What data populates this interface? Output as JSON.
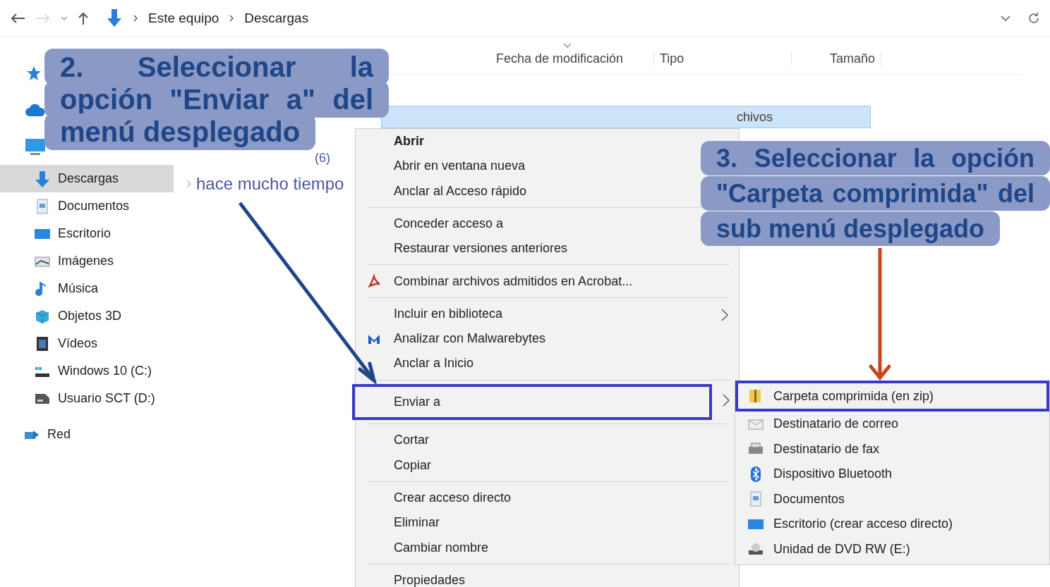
{
  "address_bar": {
    "breadcrumb": [
      "Este equipo",
      "Descargas"
    ]
  },
  "sidebar": {
    "items": [
      {
        "label": "Descargas",
        "selected": true
      },
      {
        "label": "Documentos",
        "selected": false
      },
      {
        "label": "Escritorio",
        "selected": false
      },
      {
        "label": "Imágenes",
        "selected": false
      },
      {
        "label": "Música",
        "selected": false
      },
      {
        "label": "Objetos 3D",
        "selected": false
      },
      {
        "label": "Vídeos",
        "selected": false
      },
      {
        "label": "Windows 10 (C:)",
        "selected": false
      },
      {
        "label": "Usuario SCT (D:)",
        "selected": false
      },
      {
        "label": "Red",
        "selected": false
      }
    ]
  },
  "file_list": {
    "columns": [
      "Fecha de modificación",
      "Tipo",
      "Tamaño"
    ],
    "selected_row": {
      "visible_text": "chivos",
      "selected": true
    },
    "group_count": "(6)",
    "group_header": "hace mucho tiempo"
  },
  "context_menu": {
    "items": [
      {
        "kind": "item",
        "label": "Abrir",
        "default": true,
        "selected": false
      },
      {
        "kind": "item",
        "label": "Abrir en ventana nueva",
        "default": false,
        "selected": false
      },
      {
        "kind": "item",
        "label": "Anclar al Acceso rápido",
        "default": false,
        "selected": false
      },
      {
        "kind": "separator"
      },
      {
        "kind": "item",
        "label": "Conceder acceso a",
        "default": false,
        "selected": false
      },
      {
        "kind": "item",
        "label": "Restaurar versiones anteriores",
        "default": false,
        "selected": false
      },
      {
        "kind": "separator"
      },
      {
        "kind": "item",
        "label": "Combinar archivos admitidos en Acrobat...",
        "default": false,
        "selected": false
      },
      {
        "kind": "separator"
      },
      {
        "kind": "submenu",
        "label": "Incluir en biblioteca",
        "default": false,
        "selected": false
      },
      {
        "kind": "item",
        "label": "Analizar con Malwarebytes",
        "default": false,
        "selected": false
      },
      {
        "kind": "item",
        "label": "Anclar a Inicio",
        "default": false,
        "selected": false
      },
      {
        "kind": "separator"
      },
      {
        "kind": "submenu",
        "label": "Enviar a",
        "default": false,
        "selected": true
      },
      {
        "kind": "separator"
      },
      {
        "kind": "item",
        "label": "Cortar",
        "default": false,
        "selected": false
      },
      {
        "kind": "item",
        "label": "Copiar",
        "default": false,
        "selected": false
      },
      {
        "kind": "separator"
      },
      {
        "kind": "item",
        "label": "Crear acceso directo",
        "default": false,
        "selected": false
      },
      {
        "kind": "item",
        "label": "Eliminar",
        "default": false,
        "selected": false
      },
      {
        "kind": "item",
        "label": "Cambiar nombre",
        "default": false,
        "selected": false
      },
      {
        "kind": "separator"
      },
      {
        "kind": "item",
        "label": "Propiedades",
        "default": false,
        "selected": false
      }
    ]
  },
  "send_to_menu": {
    "items": [
      {
        "label": "Carpeta comprimida (en zip)",
        "selected": true
      },
      {
        "label": "Destinatario de correo",
        "selected": false
      },
      {
        "label": "Destinatario de fax",
        "selected": false
      },
      {
        "label": "Dispositivo Bluetooth",
        "selected": false
      },
      {
        "label": "Documentos",
        "selected": false
      },
      {
        "label": "Escritorio (crear acceso directo)",
        "selected": false
      },
      {
        "label": "Unidad de DVD RW (E:)",
        "selected": false
      }
    ]
  },
  "callouts": [
    {
      "text": "2. Seleccionar la opción \"Enviar a\" del menú desplegado"
    },
    {
      "text": "3. Seleccionar la opción \"Carpeta comprimida\" del sub menú desplegado"
    }
  ]
}
